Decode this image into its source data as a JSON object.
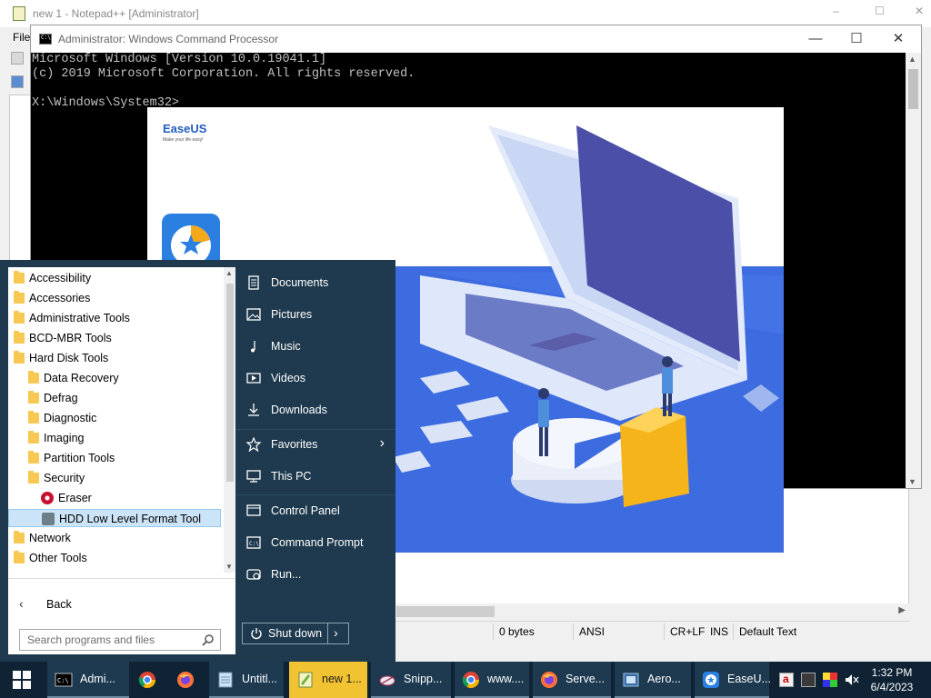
{
  "notepad": {
    "title": "new 1 - Notepad++ [Administrator]",
    "menu_first": "File",
    "status": {
      "bytes": "0 bytes",
      "encoding": "ANSI",
      "eol": "CR+LF",
      "mode": "INS",
      "lang": "Default Text"
    }
  },
  "cmd": {
    "title": "Administrator: Windows Command Processor",
    "lines": [
      "Microsoft Windows [Version 10.0.19041.1]",
      "(c) 2019 Microsoft Corporation. All rights reserved.",
      "",
      "X:\\Windows\\System32>"
    ]
  },
  "splash": {
    "brand": "EaseUS",
    "tagline": "Make your life easy!"
  },
  "start_menu": {
    "programs": [
      {
        "label": "Accessibility",
        "type": "folder",
        "indent": 0
      },
      {
        "label": "Accessories",
        "type": "folder",
        "indent": 0
      },
      {
        "label": "Administrative Tools",
        "type": "folder",
        "indent": 0
      },
      {
        "label": "BCD-MBR Tools",
        "type": "folder",
        "indent": 0
      },
      {
        "label": "Hard Disk Tools",
        "type": "folder",
        "indent": 0
      },
      {
        "label": "Data Recovery",
        "type": "folder",
        "indent": 1
      },
      {
        "label": "Defrag",
        "type": "folder",
        "indent": 1
      },
      {
        "label": "Diagnostic",
        "type": "folder",
        "indent": 1
      },
      {
        "label": "Imaging",
        "type": "folder",
        "indent": 1
      },
      {
        "label": "Partition Tools",
        "type": "folder",
        "indent": 1
      },
      {
        "label": "Security",
        "type": "folder",
        "indent": 1
      },
      {
        "label": "Eraser",
        "type": "app",
        "indent": 2,
        "icon": "eraser-icon"
      },
      {
        "label": "HDD Low Level Format Tool",
        "type": "app",
        "indent": 2,
        "icon": "hdd-tool-icon",
        "selected": true
      },
      {
        "label": "Network",
        "type": "folder",
        "indent": 0
      },
      {
        "label": "Other Tools",
        "type": "folder",
        "indent": 0
      }
    ],
    "back_label": "Back",
    "search_placeholder": "Search programs and files",
    "places": [
      {
        "label": "Documents",
        "icon": "documents-icon"
      },
      {
        "label": "Pictures",
        "icon": "pictures-icon"
      },
      {
        "label": "Music",
        "icon": "music-icon"
      },
      {
        "label": "Videos",
        "icon": "videos-icon"
      },
      {
        "label": "Downloads",
        "icon": "downloads-icon"
      },
      {
        "label": "Favorites",
        "icon": "star-icon",
        "submenu": true
      },
      {
        "label": "This PC",
        "icon": "computer-icon"
      },
      {
        "label": "Control Panel",
        "icon": "control-panel-icon"
      },
      {
        "label": "Command Prompt",
        "icon": "cmd-icon"
      },
      {
        "label": "Run...",
        "icon": "run-icon"
      }
    ],
    "shutdown_label": "Shut down"
  },
  "taskbar": {
    "items": [
      {
        "label": "Admi...",
        "icon": "cmd-icon",
        "kind": "button"
      },
      {
        "label": "",
        "icon": "chrome-icon",
        "kind": "pin"
      },
      {
        "label": "",
        "icon": "firefox-icon",
        "kind": "pin"
      },
      {
        "label": "Untitl...",
        "icon": "notepad-icon",
        "kind": "button"
      },
      {
        "label": "new 1...",
        "icon": "notepadpp-icon",
        "kind": "button",
        "active": true
      },
      {
        "label": "Snipp...",
        "icon": "snipping-icon",
        "kind": "button"
      },
      {
        "label": "www....",
        "icon": "chrome-icon",
        "kind": "button"
      },
      {
        "label": "Serve...",
        "icon": "firefox-icon",
        "kind": "button"
      },
      {
        "label": "Aero...",
        "icon": "aero-icon",
        "kind": "button"
      },
      {
        "label": "EaseU...",
        "icon": "easeus-icon",
        "kind": "button"
      }
    ],
    "clock_time": "1:32 PM",
    "clock_date": "6/4/2023"
  },
  "colors": {
    "start_bg": "#1f3a4e",
    "taskbar_bg": "#0f2335",
    "active_task": "#f1c232",
    "splash_blue": "#3d6be0",
    "folder": "#f7c953"
  }
}
